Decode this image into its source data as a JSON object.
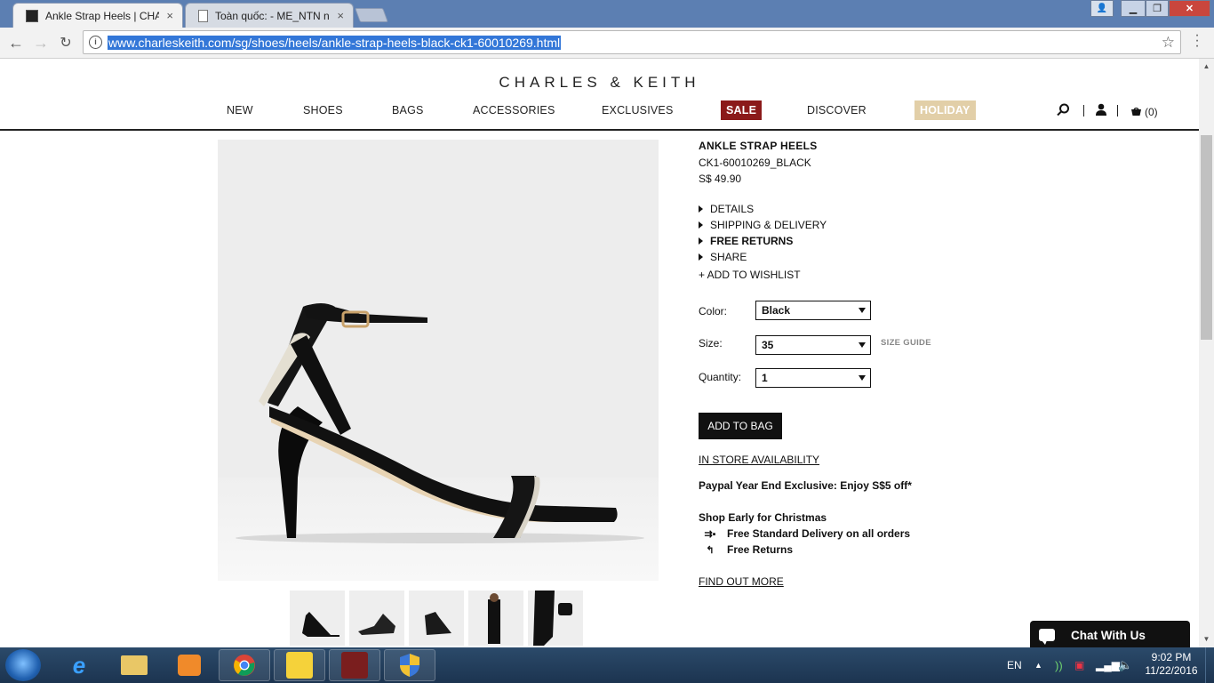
{
  "browser": {
    "tabs": [
      {
        "title": "Ankle Strap Heels | CHAR",
        "close": "×"
      },
      {
        "title": "Toàn quốc: - ME_NTN nh",
        "close": "×"
      }
    ],
    "url": "www.charleskeith.com/sg/shoes/heels/ankle-strap-heels-black-ck1-60010269.html",
    "window_controls": {
      "minimize": "▁",
      "maximize": "❐",
      "close": "✕"
    },
    "user_icon": "👤"
  },
  "site": {
    "logo": "CHARLES & KEITH",
    "nav": [
      "NEW",
      "SHOES",
      "BAGS",
      "ACCESSORIES",
      "EXCLUSIVES",
      "SALE",
      "DISCOVER",
      "HOLIDAY"
    ],
    "cart_count": "(0)"
  },
  "product": {
    "title": "ANKLE STRAP HEELS",
    "code": "CK1-60010269_BLACK",
    "price": "S$ 49.90",
    "accordion": [
      "DETAILS",
      "SHIPPING & DELIVERY",
      "FREE RETURNS",
      "SHARE"
    ],
    "wishlist": "+ ADD TO WISHLIST",
    "color_label": "Color:",
    "color_value": "Black",
    "size_label": "Size:",
    "size_value": "35",
    "size_guide": "SIZE GUIDE",
    "qty_label": "Quantity:",
    "qty_value": "1",
    "add_to_bag": "ADD TO BAG",
    "in_store": "IN STORE AVAILABILITY",
    "paypal": "Paypal Year End Exclusive: Enjoy S$5 off*",
    "shop_early": "Shop Early for Christmas",
    "free_delivery": "Free Standard Delivery on all orders",
    "free_returns": "Free Returns",
    "find_out_more": "FIND OUT MORE"
  },
  "chat": {
    "label": "Chat With Us"
  },
  "taskbar": {
    "lang": "EN",
    "time": "9:02 PM",
    "date": "11/22/2016"
  },
  "colors": {
    "sale_bg": "#8b1a1a",
    "holiday_bg": "#e2cfa8",
    "selection": "#3377d8"
  }
}
